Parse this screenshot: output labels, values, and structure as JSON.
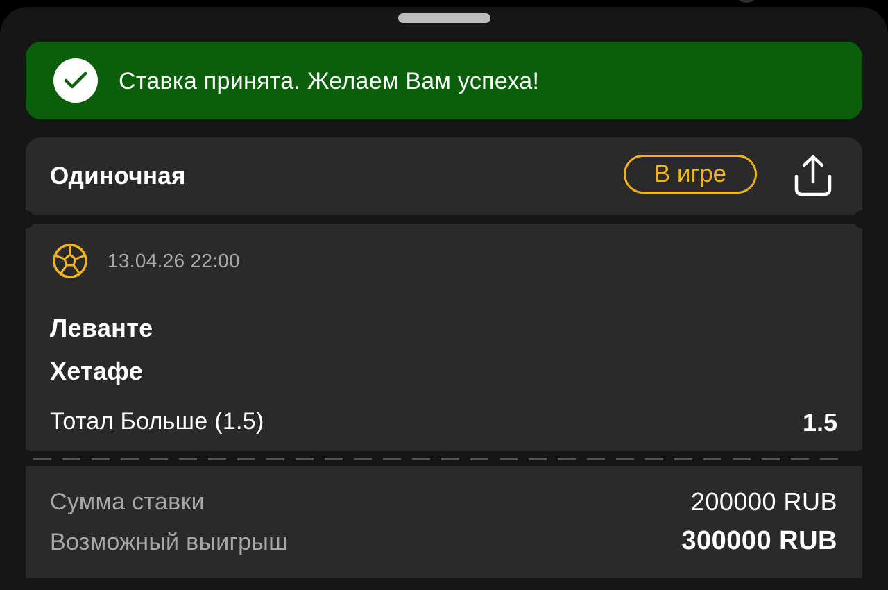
{
  "toast": {
    "icon": "checkmark-icon",
    "message": "Ставка принята. Желаем Вам успеха!",
    "color": "#0b5f0b"
  },
  "bet": {
    "type_label": "Одиночная",
    "status_label": "В игре",
    "status_color": "#f0b41a",
    "share_icon": "share-icon"
  },
  "event": {
    "sport_icon": "soccer-ball-icon",
    "datetime": "13.04.26 22:00",
    "home_team": "Леванте",
    "away_team": "Хетафе",
    "market": "Тотал Больше (1.5)",
    "odds": "1.5"
  },
  "summary": {
    "stake_label": "Сумма ставки",
    "stake_value": "200000 RUB",
    "payout_label": "Возможный выигрыш",
    "payout_value": "300000 RUB"
  }
}
